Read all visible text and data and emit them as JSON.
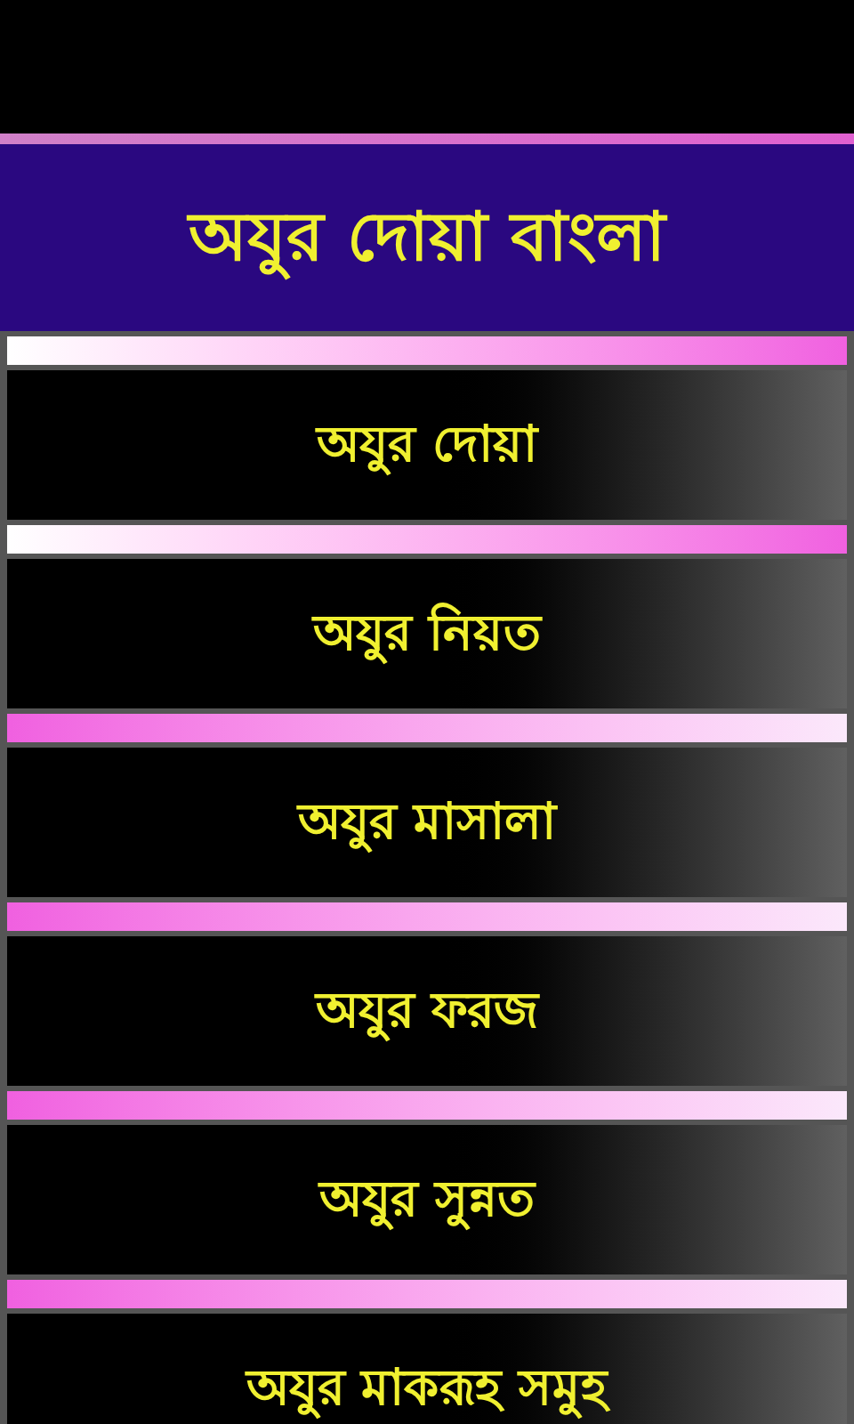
{
  "header": {
    "title": "অযুর দোয়া বাংলা"
  },
  "menu_items": [
    {
      "label": "অযুর দোয়া"
    },
    {
      "label": "অযুর নিয়ত"
    },
    {
      "label": "অযুর মাসালা"
    },
    {
      "label": "অযুর ফরজ"
    },
    {
      "label": "অযুর সুন্নত"
    },
    {
      "label": "অযুর মাকরূহ সমুহ"
    }
  ]
}
